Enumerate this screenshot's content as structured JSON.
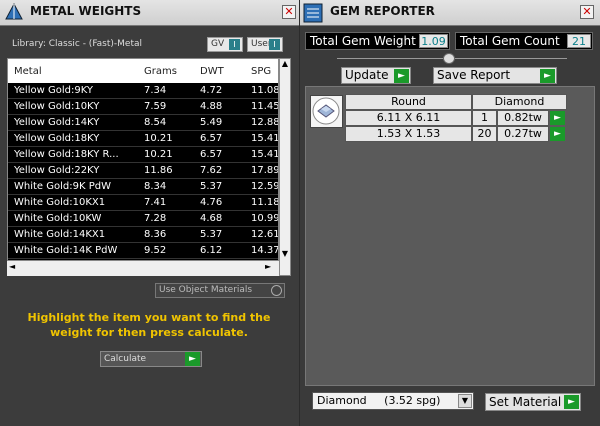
{
  "metal_panel": {
    "title": "METAL WEIGHTS",
    "library_label": "Library: Classic - (Fast)-Metal",
    "toggle_gv": "GV",
    "toggle_user": "User",
    "columns": [
      "Metal",
      "Grams",
      "DWT",
      "SPG"
    ],
    "rows": [
      [
        "Yellow Gold:9KY",
        "7.34",
        "4.72",
        "11.08"
      ],
      [
        "Yellow Gold:10KY",
        "7.59",
        "4.88",
        "11.45"
      ],
      [
        "Yellow Gold:14KY",
        "8.54",
        "5.49",
        "12.88"
      ],
      [
        "Yellow Gold:18KY",
        "10.21",
        "6.57",
        "15.41"
      ],
      [
        "Yellow Gold:18KY R...",
        "10.21",
        "6.57",
        "15.41"
      ],
      [
        "Yellow Gold:22KY",
        "11.86",
        "7.62",
        "17.89"
      ],
      [
        "White Gold:9K PdW",
        "8.34",
        "5.37",
        "12.59"
      ],
      [
        "White Gold:10KX1",
        "7.41",
        "4.76",
        "11.18"
      ],
      [
        "White Gold:10KW",
        "7.28",
        "4.68",
        "10.99"
      ],
      [
        "White Gold:14KX1",
        "8.36",
        "5.37",
        "12.61"
      ],
      [
        "White Gold:14K PdW",
        "9.52",
        "6.12",
        "14.37"
      ]
    ],
    "use_object_materials": "Use Object Materials",
    "hint": "Highlight the item you want to find the weight for then press calculate.",
    "calculate_label": "Calculate"
  },
  "gem_panel": {
    "title": "GEM REPORTER",
    "total_weight_label": "Total Gem Weight",
    "total_weight_value": "1.09",
    "total_count_label": "Total Gem Count",
    "total_count_value": "21",
    "update_label": "Update",
    "save_report_label": "Save Report",
    "table_headers": [
      "Round",
      "Diamond"
    ],
    "gem_rows": [
      [
        "6.11 X 6.11",
        "1",
        "0.82tw"
      ],
      [
        "1.53 X 1.53",
        "20",
        "0.27tw"
      ]
    ],
    "material_select": "Diamond     (3.52 spg)",
    "set_material_label": "Set Material"
  },
  "icons": {
    "play": "►",
    "close": "✕",
    "down": "▼",
    "up": "▲"
  }
}
